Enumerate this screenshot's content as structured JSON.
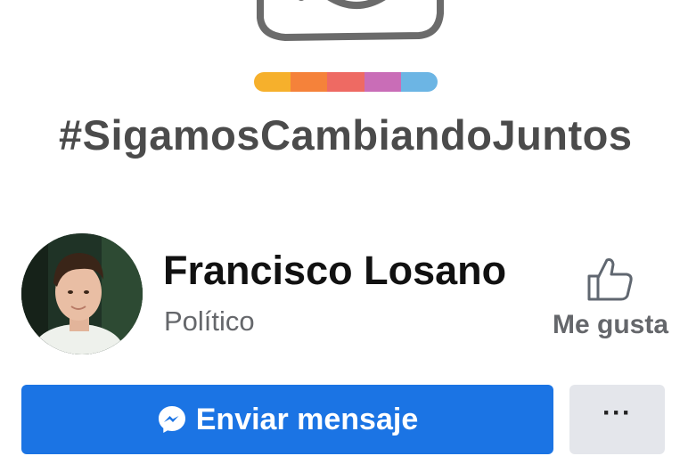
{
  "cover": {
    "hashtag": "#SigamosCambiandoJuntos",
    "stripe_colors": [
      "#f6b02c",
      "#f5823a",
      "#ee6a63",
      "#c96db7",
      "#6cb5e4"
    ]
  },
  "profile": {
    "name": "Francisco Losano",
    "category": "Político"
  },
  "like": {
    "label": "Me gusta",
    "icon": "thumbs-up-icon"
  },
  "actions": {
    "message_label": "Enviar mensaje",
    "message_icon": "messenger-icon",
    "more_label": "···"
  },
  "colors": {
    "primary": "#1b74e4",
    "secondary_button": "#e4e6eb",
    "muted_text": "#65676b"
  }
}
